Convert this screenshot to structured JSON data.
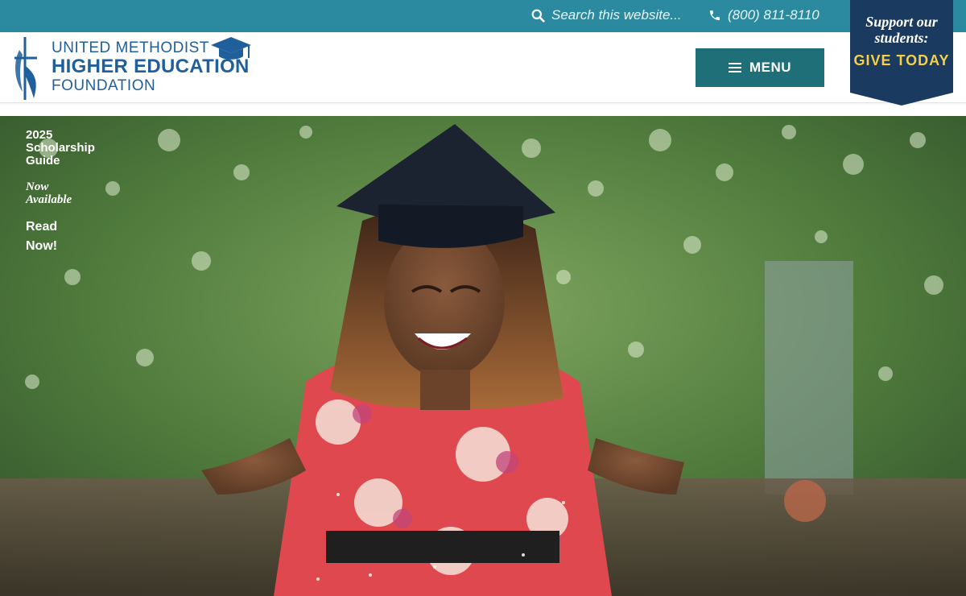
{
  "topbar": {
    "search_placeholder": "Search this website...",
    "phone": "(800) 811-8110"
  },
  "logo": {
    "line1": "UNITED METHODIST",
    "line2": "HIGHER EDUCATION",
    "line3": "FOUNDATION"
  },
  "menu": {
    "label": "MENU"
  },
  "give": {
    "support_text": "Support our students:",
    "cta": "GIVE TODAY"
  },
  "promo": {
    "title": "2025 Scholarship Guide",
    "subtitle": "Now Available",
    "link": "Read Now!"
  },
  "hero": {
    "image_alt": "Smiling graduate in a floral dress and mortarboard with confetti"
  },
  "colors": {
    "topbar": "#2b8a9f",
    "menu_button": "#1f6f78",
    "give_badge": "#1a3a5f",
    "give_accent": "#f3cf4d",
    "brand_blue": "#1f5f9b"
  }
}
